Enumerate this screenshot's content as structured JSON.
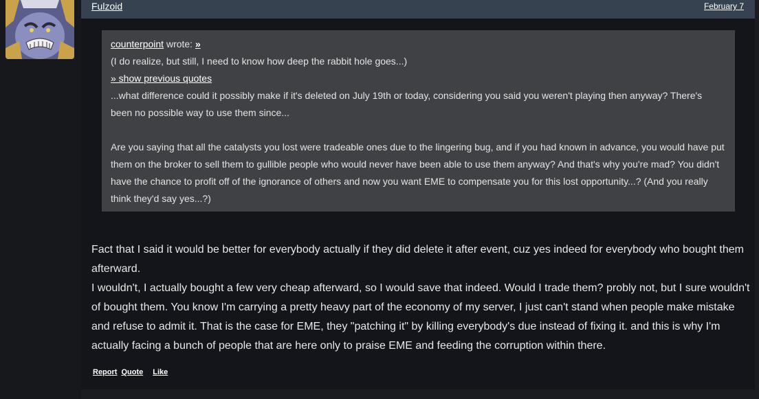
{
  "post": {
    "username": "Fulzoid",
    "date": "February 7",
    "avatar_icon": "warrior-avatar",
    "quote": {
      "author": "counterpoint",
      "wrote_label": " wrote: ",
      "jump_label": "»",
      "line1": "(I do realize, but still, I need to know how deep the rabbit hole goes...)",
      "show_previous": "» show previous quotes",
      "para1": "...what difference could it possibly make if it's deleted on July 19th or today, considering you said you weren't playing then anyway? There's been no possible way to use them since...",
      "para2": "Are you saying that all the catalysts you lost were tradeable ones due to the lingering bug, and if you had known in advance, you would have put them on the broker to sell them to gullible people who would never have been able to use them anyway? And that's why you're mad? You didn't have the chance to profit off of the ignorance of others and now you want EME to compensate you for this lost opportunity...? (And you really think they'd say yes...?)"
    },
    "body": {
      "para1": "Fact that I said it would be better for everybody actually if they did delete it after event, cuz yes indeed for everybody who bought them afterward.",
      "para2": "I wouldn't, I actually bought a few very cheap afterward, so I would save that indeed. Would I trade them? probly not, but I sure wouldn't of bought them. You know I'm carrying a pretty heavy part of the economy of my server, I just can't stand when people make mistake and refuse to admit it. That is the case for EME, they \"patching it\" by killing everybody's due instead of fixing it. and this is why I'm actually facing a bunch of people that are here only to praise EME and feeding the corruption within there."
    },
    "actions": {
      "report": "Report",
      "quote": "Quote",
      "like": "Like"
    }
  }
}
